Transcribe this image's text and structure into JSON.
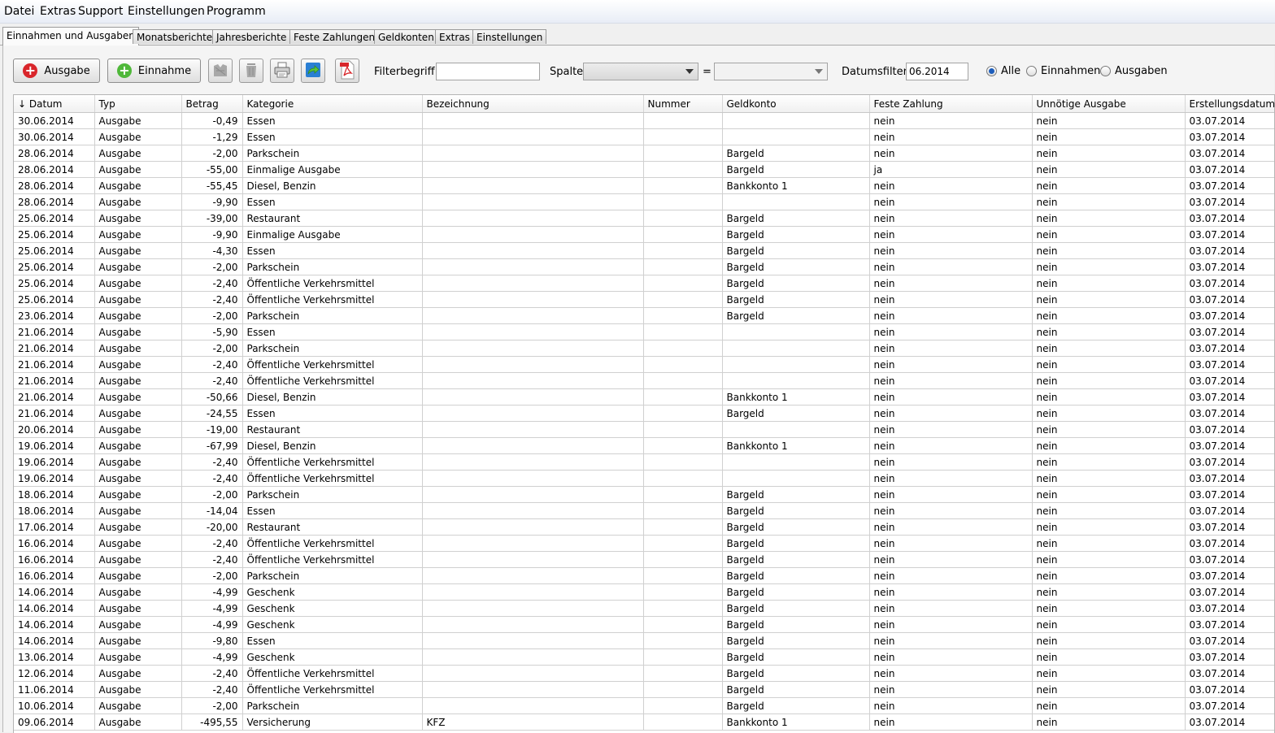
{
  "menu": [
    "Datei",
    "Extras",
    "Support",
    "Einstellungen",
    "Programm"
  ],
  "tabs": [
    "Einnahmen und Ausgaben",
    "Monatsberichte",
    "Jahresberichte",
    "Feste Zahlungen",
    "Geldkonten",
    "Extras",
    "Einstellungen"
  ],
  "active_tab": "Einnahmen und Ausgaben",
  "toolbar": {
    "ausgabe_label": "Ausgabe",
    "einnahme_label": "Einnahme",
    "filter_label": "Filterbegriff:",
    "filter_value": "",
    "spalte_label": "Spalte",
    "spalte_value": "",
    "equals": "=",
    "vergleich_value": "",
    "datum_label": "Datumsfilter:",
    "datum_value": "06.2014",
    "radio_alle": "Alle",
    "radio_einnahmen": "Einnahmen",
    "radio_ausgaben": "Ausgaben",
    "selected_radio": "Alle"
  },
  "icons": {
    "ausgabe": "add-red-icon",
    "einnahme": "add-green-icon",
    "edit": "edit-disabled-icon",
    "delete": "trash-disabled-icon",
    "print": "printer-icon",
    "export": "export-arrow-icon",
    "pdf": "pdf-icon"
  },
  "colors": {
    "ausgabe_icon": "#d9262b",
    "einnahme_icon": "#4fb83a",
    "radio_selected": "#1d5dbb"
  },
  "table": {
    "sort_indicator": "↓",
    "columns": [
      "Datum",
      "Typ",
      "Betrag",
      "Kategorie",
      "Bezeichnung",
      "Nummer",
      "Geldkonto",
      "Feste Zahlung",
      "Unnötige Ausgabe",
      "Erstellungsdatum"
    ],
    "rows": [
      [
        "30.06.2014",
        "Ausgabe",
        "-0,49",
        "Essen",
        "",
        "",
        "",
        "nein",
        "nein",
        "03.07.2014"
      ],
      [
        "30.06.2014",
        "Ausgabe",
        "-1,29",
        "Essen",
        "",
        "",
        "",
        "nein",
        "nein",
        "03.07.2014"
      ],
      [
        "28.06.2014",
        "Ausgabe",
        "-2,00",
        "Parkschein",
        "",
        "",
        "Bargeld",
        "nein",
        "nein",
        "03.07.2014"
      ],
      [
        "28.06.2014",
        "Ausgabe",
        "-55,00",
        "Einmalige Ausgabe",
        "",
        "",
        "Bargeld",
        "ja",
        "nein",
        "03.07.2014"
      ],
      [
        "28.06.2014",
        "Ausgabe",
        "-55,45",
        "Diesel, Benzin",
        "",
        "",
        "Bankkonto 1",
        "nein",
        "nein",
        "03.07.2014"
      ],
      [
        "28.06.2014",
        "Ausgabe",
        "-9,90",
        "Essen",
        "",
        "",
        "",
        "nein",
        "nein",
        "03.07.2014"
      ],
      [
        "25.06.2014",
        "Ausgabe",
        "-39,00",
        "Restaurant",
        "",
        "",
        "Bargeld",
        "nein",
        "nein",
        "03.07.2014"
      ],
      [
        "25.06.2014",
        "Ausgabe",
        "-9,90",
        "Einmalige Ausgabe",
        "",
        "",
        "Bargeld",
        "nein",
        "nein",
        "03.07.2014"
      ],
      [
        "25.06.2014",
        "Ausgabe",
        "-4,30",
        "Essen",
        "",
        "",
        "Bargeld",
        "nein",
        "nein",
        "03.07.2014"
      ],
      [
        "25.06.2014",
        "Ausgabe",
        "-2,00",
        "Parkschein",
        "",
        "",
        "Bargeld",
        "nein",
        "nein",
        "03.07.2014"
      ],
      [
        "25.06.2014",
        "Ausgabe",
        "-2,40",
        "Öffentliche Verkehrsmittel",
        "",
        "",
        "Bargeld",
        "nein",
        "nein",
        "03.07.2014"
      ],
      [
        "25.06.2014",
        "Ausgabe",
        "-2,40",
        "Öffentliche Verkehrsmittel",
        "",
        "",
        "Bargeld",
        "nein",
        "nein",
        "03.07.2014"
      ],
      [
        "23.06.2014",
        "Ausgabe",
        "-2,00",
        "Parkschein",
        "",
        "",
        "Bargeld",
        "nein",
        "nein",
        "03.07.2014"
      ],
      [
        "21.06.2014",
        "Ausgabe",
        "-5,90",
        "Essen",
        "",
        "",
        "",
        "nein",
        "nein",
        "03.07.2014"
      ],
      [
        "21.06.2014",
        "Ausgabe",
        "-2,00",
        "Parkschein",
        "",
        "",
        "",
        "nein",
        "nein",
        "03.07.2014"
      ],
      [
        "21.06.2014",
        "Ausgabe",
        "-2,40",
        "Öffentliche Verkehrsmittel",
        "",
        "",
        "",
        "nein",
        "nein",
        "03.07.2014"
      ],
      [
        "21.06.2014",
        "Ausgabe",
        "-2,40",
        "Öffentliche Verkehrsmittel",
        "",
        "",
        "",
        "nein",
        "nein",
        "03.07.2014"
      ],
      [
        "21.06.2014",
        "Ausgabe",
        "-50,66",
        "Diesel, Benzin",
        "",
        "",
        "Bankkonto 1",
        "nein",
        "nein",
        "03.07.2014"
      ],
      [
        "21.06.2014",
        "Ausgabe",
        "-24,55",
        "Essen",
        "",
        "",
        "Bargeld",
        "nein",
        "nein",
        "03.07.2014"
      ],
      [
        "20.06.2014",
        "Ausgabe",
        "-19,00",
        "Restaurant",
        "",
        "",
        "",
        "nein",
        "nein",
        "03.07.2014"
      ],
      [
        "19.06.2014",
        "Ausgabe",
        "-67,99",
        "Diesel, Benzin",
        "",
        "",
        "Bankkonto 1",
        "nein",
        "nein",
        "03.07.2014"
      ],
      [
        "19.06.2014",
        "Ausgabe",
        "-2,40",
        "Öffentliche Verkehrsmittel",
        "",
        "",
        "",
        "nein",
        "nein",
        "03.07.2014"
      ],
      [
        "19.06.2014",
        "Ausgabe",
        "-2,40",
        "Öffentliche Verkehrsmittel",
        "",
        "",
        "",
        "nein",
        "nein",
        "03.07.2014"
      ],
      [
        "18.06.2014",
        "Ausgabe",
        "-2,00",
        "Parkschein",
        "",
        "",
        "Bargeld",
        "nein",
        "nein",
        "03.07.2014"
      ],
      [
        "18.06.2014",
        "Ausgabe",
        "-14,04",
        "Essen",
        "",
        "",
        "Bargeld",
        "nein",
        "nein",
        "03.07.2014"
      ],
      [
        "17.06.2014",
        "Ausgabe",
        "-20,00",
        "Restaurant",
        "",
        "",
        "Bargeld",
        "nein",
        "nein",
        "03.07.2014"
      ],
      [
        "16.06.2014",
        "Ausgabe",
        "-2,40",
        "Öffentliche Verkehrsmittel",
        "",
        "",
        "Bargeld",
        "nein",
        "nein",
        "03.07.2014"
      ],
      [
        "16.06.2014",
        "Ausgabe",
        "-2,40",
        "Öffentliche Verkehrsmittel",
        "",
        "",
        "Bargeld",
        "nein",
        "nein",
        "03.07.2014"
      ],
      [
        "16.06.2014",
        "Ausgabe",
        "-2,00",
        "Parkschein",
        "",
        "",
        "Bargeld",
        "nein",
        "nein",
        "03.07.2014"
      ],
      [
        "14.06.2014",
        "Ausgabe",
        "-4,99",
        "Geschenk",
        "",
        "",
        "Bargeld",
        "nein",
        "nein",
        "03.07.2014"
      ],
      [
        "14.06.2014",
        "Ausgabe",
        "-4,99",
        "Geschenk",
        "",
        "",
        "Bargeld",
        "nein",
        "nein",
        "03.07.2014"
      ],
      [
        "14.06.2014",
        "Ausgabe",
        "-4,99",
        "Geschenk",
        "",
        "",
        "Bargeld",
        "nein",
        "nein",
        "03.07.2014"
      ],
      [
        "14.06.2014",
        "Ausgabe",
        "-9,80",
        "Essen",
        "",
        "",
        "Bargeld",
        "nein",
        "nein",
        "03.07.2014"
      ],
      [
        "13.06.2014",
        "Ausgabe",
        "-4,99",
        "Geschenk",
        "",
        "",
        "Bargeld",
        "nein",
        "nein",
        "03.07.2014"
      ],
      [
        "12.06.2014",
        "Ausgabe",
        "-2,40",
        "Öffentliche Verkehrsmittel",
        "",
        "",
        "Bargeld",
        "nein",
        "nein",
        "03.07.2014"
      ],
      [
        "11.06.2014",
        "Ausgabe",
        "-2,40",
        "Öffentliche Verkehrsmittel",
        "",
        "",
        "Bargeld",
        "nein",
        "nein",
        "03.07.2014"
      ],
      [
        "10.06.2014",
        "Ausgabe",
        "-2,00",
        "Parkschein",
        "",
        "",
        "Bargeld",
        "nein",
        "nein",
        "03.07.2014"
      ],
      [
        "09.06.2014",
        "Ausgabe",
        "-495,55",
        "Versicherung",
        "KFZ",
        "",
        "Bankkonto 1",
        "nein",
        "nein",
        "03.07.2014"
      ]
    ]
  }
}
